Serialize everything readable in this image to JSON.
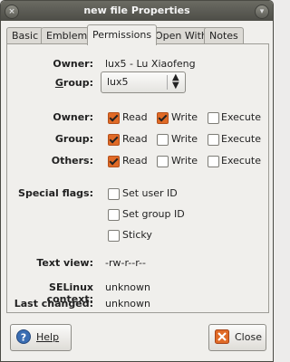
{
  "window": {
    "title": "new file Properties"
  },
  "tabs": [
    {
      "label": "Basic"
    },
    {
      "label": "Emblems"
    },
    {
      "label": "Permissions"
    },
    {
      "label": "Open With"
    },
    {
      "label": "Notes"
    }
  ],
  "owner": {
    "label": "Owner:",
    "value": "lux5 - Lu Xiaofeng"
  },
  "group": {
    "label_prefix": "G",
    "label_rest": "roup:",
    "value": "lux5"
  },
  "permissions": {
    "rows": [
      {
        "label": "Owner:",
        "read": "Read",
        "write": "Write",
        "execute": "Execute"
      },
      {
        "label": "Group:",
        "read": "Read",
        "write": "Write",
        "execute": "Execute"
      },
      {
        "label": "Others:",
        "read": "Read",
        "write": "Write",
        "execute": "Execute"
      }
    ],
    "checked": {
      "owner": {
        "read": true,
        "write": true,
        "execute": false
      },
      "group": {
        "read": true,
        "write": false,
        "execute": false
      },
      "others": {
        "read": true,
        "write": false,
        "execute": false
      }
    }
  },
  "special": {
    "label": "Special flags:",
    "set_user_id": "Set user ID",
    "set_group_id": "Set group ID",
    "sticky": "Sticky"
  },
  "text_view": {
    "label": "Text view:",
    "value": "-rw-r--r--"
  },
  "selinux": {
    "label": "SELinux context:",
    "value": "unknown"
  },
  "last_changed": {
    "label": "Last changed:",
    "value": "unknown"
  },
  "buttons": {
    "help": "Help",
    "close": "Close"
  },
  "colors": {
    "accent": "#e06a26",
    "titlebar": "#5a5a53"
  }
}
